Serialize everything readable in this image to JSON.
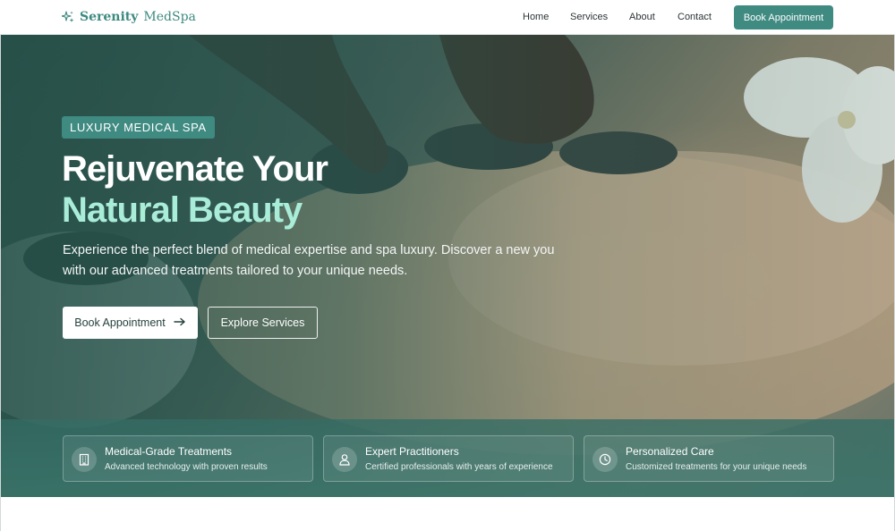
{
  "brand": {
    "name_bold": "Serenity",
    "name_light": "MedSpa",
    "icon": "sparkle-icon",
    "color": "#3d8a80"
  },
  "nav": {
    "links": [
      "Home",
      "Services",
      "About",
      "Contact"
    ],
    "cta": "Book Appointment"
  },
  "hero": {
    "badge": "LUXURY MEDICAL SPA",
    "headline_line1": "Rejuvenate Your",
    "headline_line2": "Natural Beauty",
    "subtext": "Experience the perfect blend of medical expertise and spa luxury. Discover a new you with our advanced treatments tailored to your unique needs.",
    "primary_button": "Book Appointment",
    "primary_button_icon": "arrow-right-icon",
    "secondary_button": "Explore Services",
    "accent_color": "#a9ecd8"
  },
  "features": [
    {
      "title": "Medical-Grade Treatments",
      "description": "Advanced technology with proven results",
      "icon": "building-icon"
    },
    {
      "title": "Expert Practitioners",
      "description": "Certified professionals with years of experience",
      "icon": "user-icon"
    },
    {
      "title": "Personalized Care",
      "description": "Customized treatments for your unique needs",
      "icon": "clock-icon"
    }
  ],
  "colors": {
    "primary": "#3f8a81",
    "overlay": "#22524a",
    "white": "#ffffff"
  }
}
